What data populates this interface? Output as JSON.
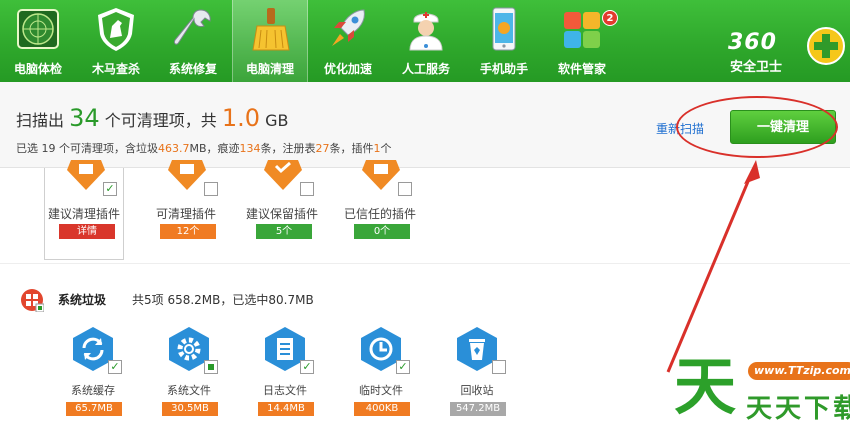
{
  "toolbar": {
    "items": [
      {
        "label": "电脑体检",
        "icon": "radar-icon"
      },
      {
        "label": "木马查杀",
        "icon": "horse-shield-icon"
      },
      {
        "label": "系统修复",
        "icon": "wrench-icon"
      },
      {
        "label": "电脑清理",
        "icon": "broom-icon"
      },
      {
        "label": "优化加速",
        "icon": "rocket-icon"
      },
      {
        "label": "人工服务",
        "icon": "doctor-icon"
      },
      {
        "label": "手机助手",
        "icon": "phone-icon"
      },
      {
        "label": "软件管家",
        "icon": "software-grid-icon",
        "badge": "2"
      }
    ],
    "active_index": 3,
    "brand_number": "360",
    "brand_text": "安全卫士"
  },
  "summary": {
    "prefix": "扫描出",
    "count": "34",
    "middle": "个可清理项，共",
    "size": "1.0",
    "unit": "GB",
    "detail_a": "已选 19 个可清理项，含垃圾",
    "detail_b": "463.7",
    "detail_c": "MB，痕迹",
    "detail_d": "134",
    "detail_e": "条，注册表",
    "detail_f": "27",
    "detail_g": "条，插件",
    "detail_h": "1",
    "detail_i": "个",
    "rescan_label": "重新扫描",
    "clean_label": "一键清理"
  },
  "plugins": [
    {
      "name": "建议清理插件",
      "tag": "详情",
      "tag_color": "#d9362b",
      "checked": true
    },
    {
      "name": "可清理插件",
      "tag": "12个",
      "tag_color": "#f07b22",
      "checked": false
    },
    {
      "name": "建议保留插件",
      "tag": "5个",
      "tag_color": "#3aa63a",
      "checked": false
    },
    {
      "name": "已信任的插件",
      "tag": "0个",
      "tag_color": "#3aa63a",
      "checked": false
    }
  ],
  "system": {
    "title": "系统垃圾",
    "desc": "共5项 658.2MB，已选中80.7MB",
    "items": [
      {
        "name": "系统缓存",
        "size": "65.7MB",
        "icon": "refresh-icon",
        "check": "checked",
        "tag_color": "#f07b22"
      },
      {
        "name": "系统文件",
        "size": "30.5MB",
        "icon": "gear-icon",
        "check": "partial",
        "tag_color": "#f07b22"
      },
      {
        "name": "日志文件",
        "size": "14.4MB",
        "icon": "document-icon",
        "check": "checked",
        "tag_color": "#f07b22"
      },
      {
        "name": "临时文件",
        "size": "400KB",
        "icon": "clock-icon",
        "check": "checked",
        "tag_color": "#f07b22"
      },
      {
        "name": "回收站",
        "size": "547.2MB",
        "icon": "recycle-bin-icon",
        "check": "unchecked",
        "tag_color": "#a8a8a8"
      }
    ]
  },
  "watermark": {
    "url": "www.TTzip.com",
    "text": "天天下载",
    "big": "天"
  }
}
